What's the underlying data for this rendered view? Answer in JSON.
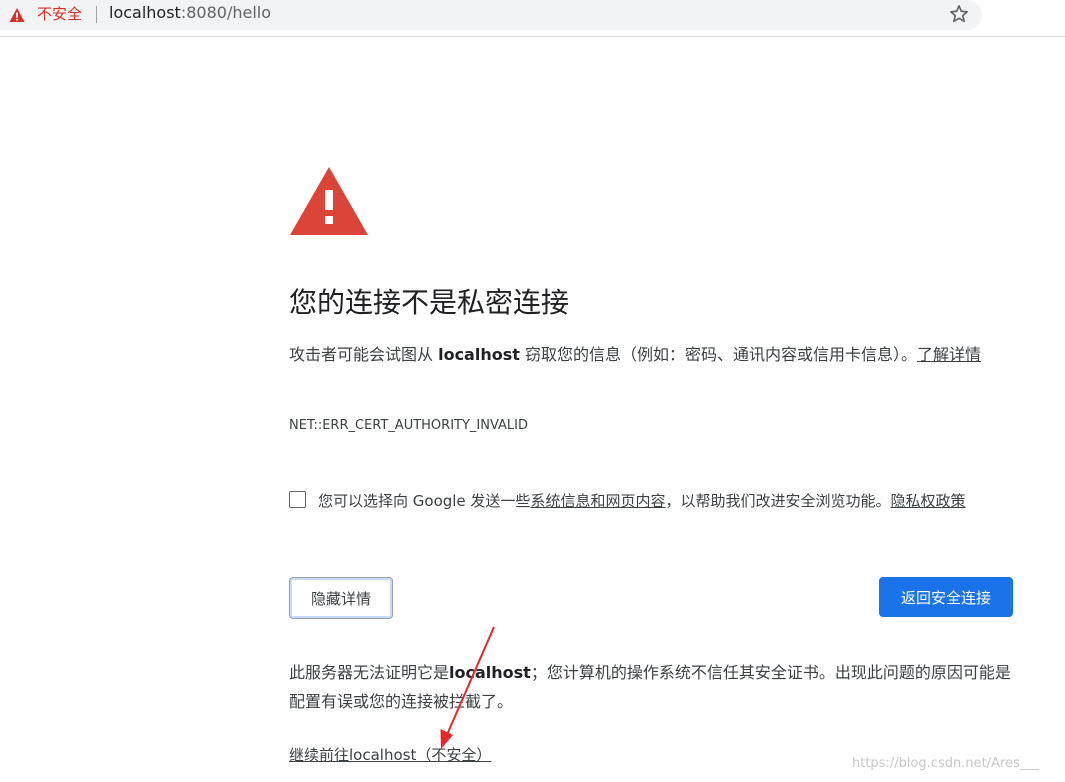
{
  "address_bar": {
    "security_label": "不安全",
    "url_host": "localhost",
    "url_rest": ":8080/hello",
    "security_icon": "warning-triangle-icon",
    "bookmark_icon": "star-icon"
  },
  "interstitial": {
    "icon": "warning-triangle-icon",
    "heading": "您的连接不是私密连接",
    "intro_prefix": "攻击者可能会试图从 ",
    "intro_host": "localhost",
    "intro_suffix": " 窃取您的信息（例如：密码、通讯内容或信用卡信息）。",
    "learn_more": "了解详情",
    "error_code": "NET::ERR_CERT_AUTHORITY_INVALID",
    "checkbox": {
      "checked": false,
      "text_prefix": "您可以选择向 Google 发送一些",
      "link_system_info": "系统信息和网页内容",
      "text_middle": "，以帮助我们改进安全浏览功能。",
      "link_privacy": "隐私权政策"
    },
    "hide_details_button": "隐藏详情",
    "back_to_safety_button": "返回安全连接",
    "details_prefix": "此服务器无法证明它是",
    "details_host": "localhost",
    "details_suffix": "；您计算机的操作系统不信任其安全证书。出现此问题的原因可能是配置有误或您的连接被拦截了。",
    "proceed_link": "继续前往localhost（不安全）"
  },
  "watermark": "https://blog.csdn.net/Ares___",
  "colors": {
    "danger": "#d93025",
    "primary_button": "#1a73e8",
    "annotation_arrow": "#e8262a"
  }
}
